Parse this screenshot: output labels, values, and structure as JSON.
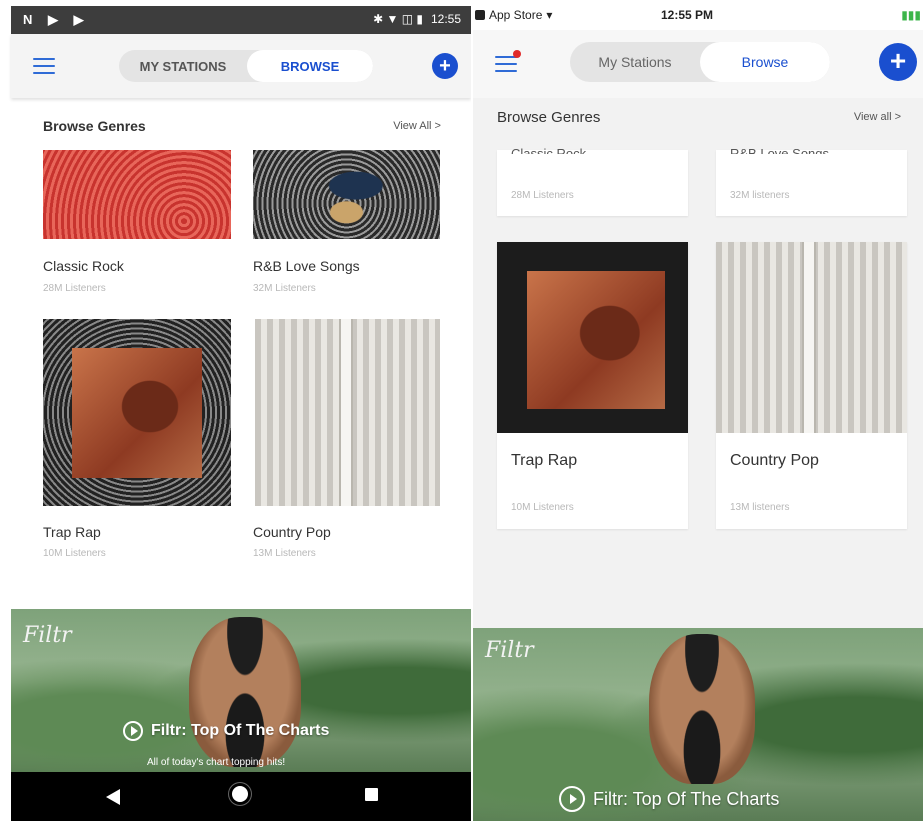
{
  "android": {
    "status": {
      "left_icons": "N ▶ ▶",
      "right_icons": "✱ ▼ ◫ ▮",
      "time": "12:55"
    },
    "tabs": {
      "my_stations": "MY STATIONS",
      "browse": "BROWSE"
    },
    "section": {
      "title": "Browse Genres",
      "view_all": "View All >"
    },
    "genres": [
      {
        "title": "Classic Rock",
        "listeners": "28M Listeners"
      },
      {
        "title": "R&B Love Songs",
        "listeners": "32M Listeners"
      },
      {
        "title": "Trap Rap",
        "listeners": "10M Listeners"
      },
      {
        "title": "Country Pop",
        "listeners": "13M Listeners"
      }
    ],
    "banner": {
      "logo": "Filtr",
      "title": "Filtr: Top Of The Charts",
      "subtitle": "All of today's chart topping hits!"
    }
  },
  "ios": {
    "status": {
      "carrier": "App Store",
      "wifi": "▾",
      "time": "12:55 PM",
      "battery": "▮▮▮"
    },
    "tabs": {
      "my_stations": "My Stations",
      "browse": "Browse"
    },
    "section": {
      "title": "Browse Genres",
      "view_all": "View all >"
    },
    "top_partial": [
      {
        "title": "Classic Rock",
        "listeners": "28M Listeners"
      },
      {
        "title": "R&B Love Songs",
        "listeners": "32M listeners"
      }
    ],
    "genres": [
      {
        "title": "Trap Rap",
        "listeners": "10M Listeners"
      },
      {
        "title": "Country Pop",
        "listeners": "13M listeners"
      }
    ],
    "banner": {
      "logo": "Filtr",
      "title": "Filtr: Top Of The Charts"
    }
  },
  "colors": {
    "accent": "#1a4fcf",
    "notify": "#e02a2a"
  }
}
